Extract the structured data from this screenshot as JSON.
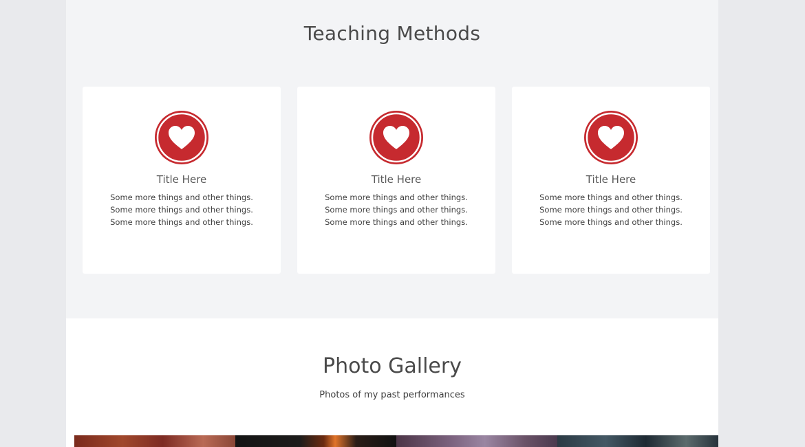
{
  "teaching": {
    "title": "Teaching Methods",
    "cards": [
      {
        "icon": "heart-icon",
        "title": "Title Here",
        "lines": [
          "Some more things and other things.",
          "Some more things and other things.",
          "Some more things and other things."
        ]
      },
      {
        "icon": "heart-icon",
        "title": "Title Here",
        "lines": [
          "Some more things and other things.",
          "Some more things and other things.",
          "Some more things and other things."
        ]
      },
      {
        "icon": "heart-icon",
        "title": "Title Here",
        "lines": [
          "Some more things and other things.",
          "Some more things and other things.",
          "Some more things and other things."
        ]
      }
    ]
  },
  "gallery": {
    "title": "Photo Gallery",
    "subtitle": "Photos of my past performances",
    "photos": [
      "performance-photo",
      "performance-photo",
      "performance-photo",
      "performance-photo"
    ]
  },
  "colors": {
    "accent": "#c62a2f",
    "section_background": "#f3f4f6",
    "page_background": "#e9eaed",
    "card_background": "#ffffff"
  }
}
